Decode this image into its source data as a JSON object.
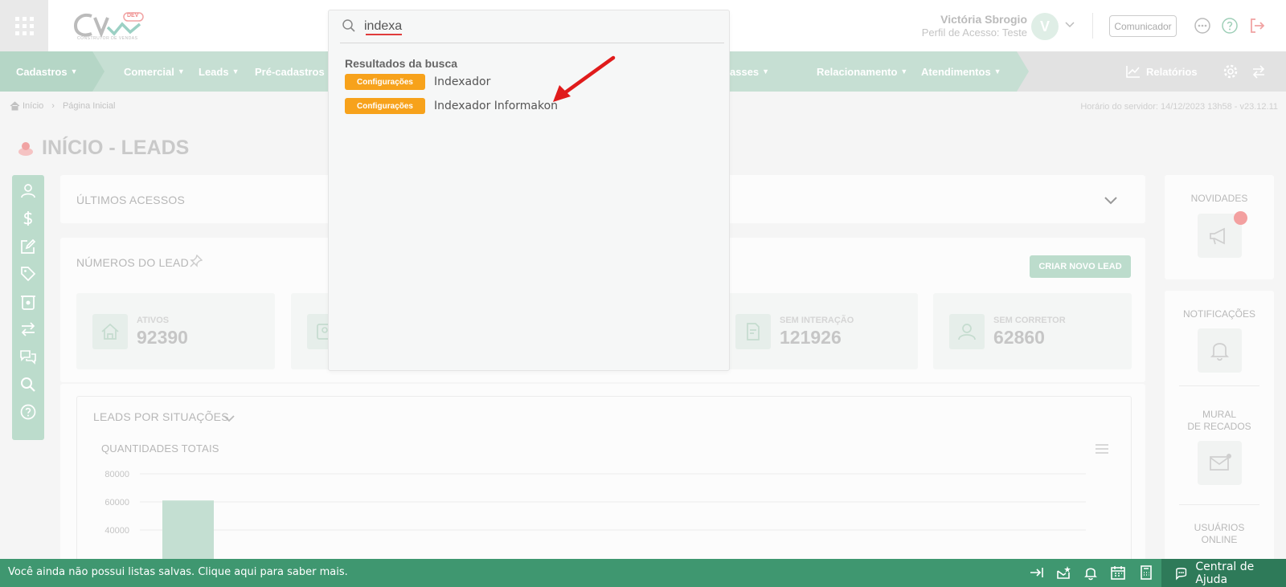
{
  "header": {
    "logo_badge": "DEV",
    "logo_tagline": "CONSTRUTOR DE VENDAS",
    "user_name": "Victória Sbrogio",
    "user_profile": "Perfil de Acesso: Teste",
    "avatar_initial": "V",
    "comunicador_label": "Comunicador"
  },
  "nav": {
    "items": [
      {
        "label": "Cadastros"
      },
      {
        "label": "Comercial"
      },
      {
        "label": "Leads"
      },
      {
        "label": "Pré-cadastros"
      },
      {
        "label": "asses"
      },
      {
        "label": "Relacionamento"
      },
      {
        "label": "Atendimentos"
      }
    ],
    "relatorios_label": "Relatórios"
  },
  "breadcrumb": {
    "home": "Início",
    "current": "Página Inicial",
    "server_time": "Horário do servidor: 14/12/2023 13h58 - v23.12.11"
  },
  "page": {
    "title": "INÍCIO - LEADS"
  },
  "ultimos": {
    "title": "ÚLTIMOS ACESSOS"
  },
  "numeros": {
    "title": "NÚMEROS DO LEAD",
    "create_button": "CRIAR NOVO LEAD",
    "stats": [
      {
        "label": "ATIVOS",
        "value": "92390"
      },
      {
        "label": "SEM INTERAÇÃO",
        "value": "121926"
      },
      {
        "label": "SEM CORRETOR",
        "value": "62860"
      }
    ]
  },
  "chart_section": {
    "title": "LEADS POR SITUAÇÕES",
    "subtitle": "QUANTIDADES TOTAIS"
  },
  "chart_data": {
    "type": "bar",
    "title": "QUANTIDADES TOTAIS",
    "y_ticks": [
      "80000",
      "60000",
      "40000"
    ],
    "ylim": [
      20000,
      80000
    ],
    "categories": [
      ""
    ],
    "values": [
      61000
    ]
  },
  "right_panels": {
    "novidades": "NOVIDADES",
    "notificacoes": "NOTIFICAÇÕES",
    "mural_line1": "MURAL",
    "mural_line2": "DE RECADOS",
    "usuarios_line1": "USUÁRIOS",
    "usuarios_line2": "ONLINE"
  },
  "search": {
    "value": "indexa",
    "results_title": "Resultados da busca",
    "results": [
      {
        "badge": "Configurações",
        "label": "Indexador"
      },
      {
        "badge": "Configurações",
        "label": "Indexador Informakon"
      }
    ]
  },
  "footer": {
    "message": "Você ainda não possui listas salvas. Clique aqui para saber mais.",
    "help_label": "Central de Ajuda"
  },
  "colors": {
    "nav_green": "#c6dfd3",
    "badge_orange": "#f7a21b",
    "footer_green": "#3f9770",
    "arrow_red": "#e01b1b"
  }
}
